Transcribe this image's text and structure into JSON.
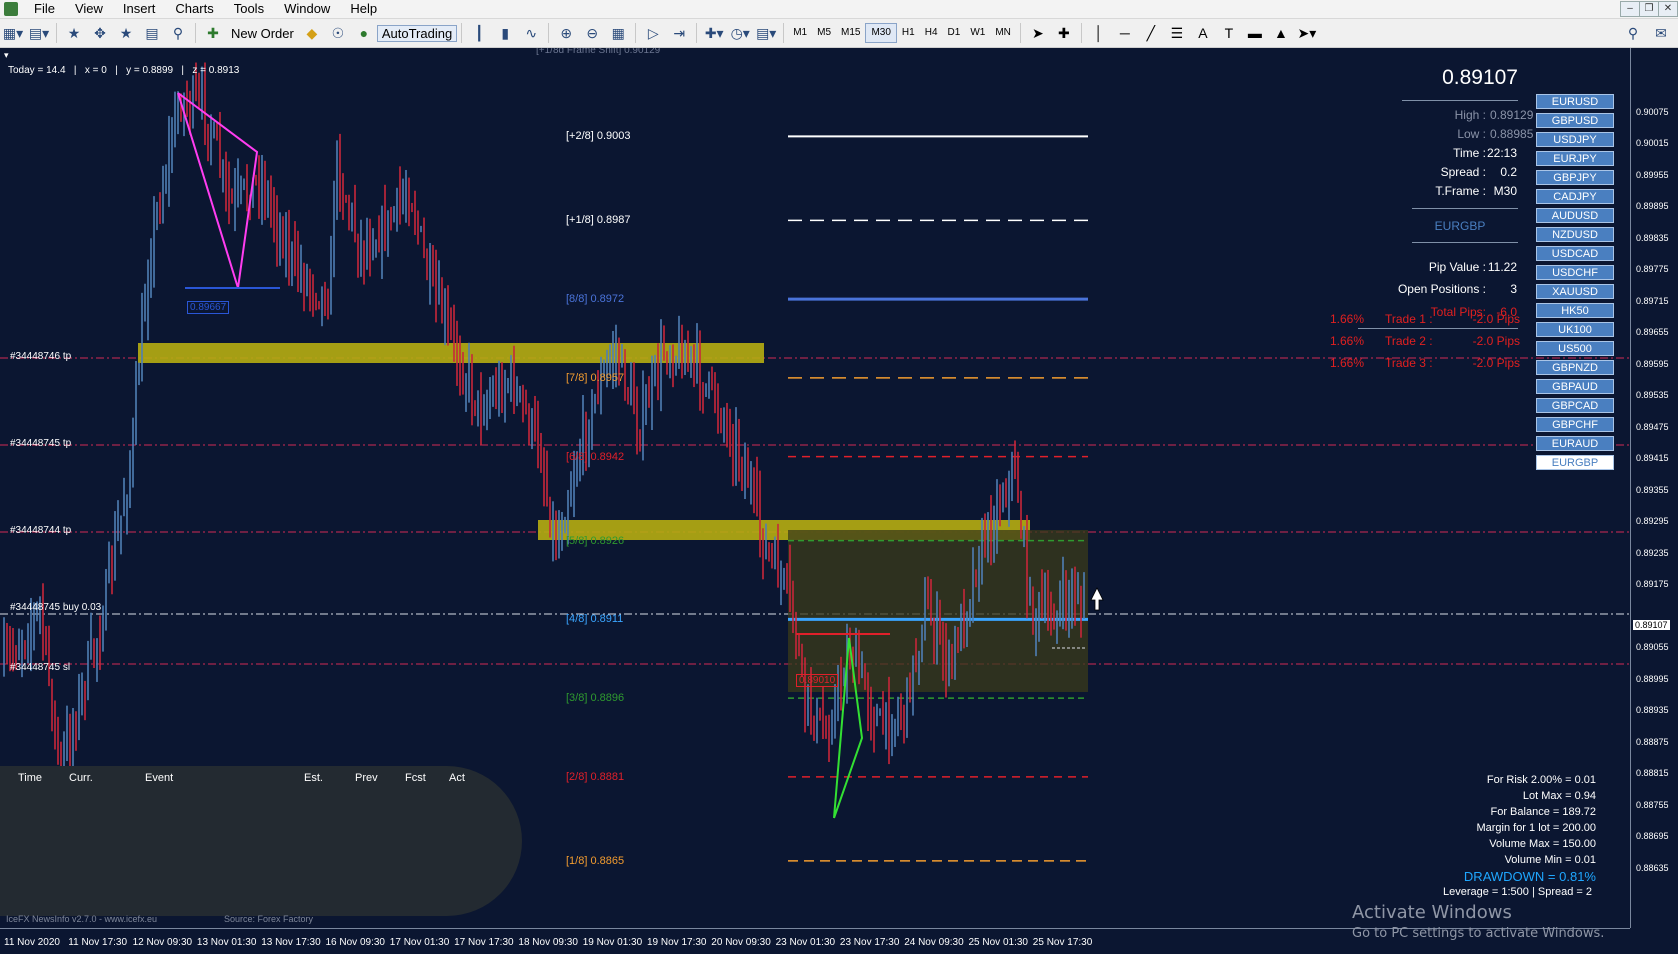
{
  "menu": [
    "File",
    "View",
    "Insert",
    "Charts",
    "Tools",
    "Window",
    "Help"
  ],
  "toolbar": {
    "new_order": "New Order",
    "autotrading": "AutoTrading",
    "timeframes": [
      "M1",
      "M5",
      "M15",
      "M30",
      "H1",
      "H4",
      "D1",
      "W1",
      "MN"
    ],
    "active_timeframe": "M30"
  },
  "chart": {
    "crosshair": {
      "today": "Today = 14.4",
      "x": "x = 0",
      "y": "y = 0.8899",
      "z": "z = 0.8913"
    },
    "frame_shift_label": "[+1/8d Frame Shift]  0.90129",
    "murrey_levels": [
      {
        "label": "[+2/8]",
        "value": "0.9003",
        "color": "#ffffff"
      },
      {
        "label": "[+1/8]",
        "value": "0.8987",
        "color": "#ffffff"
      },
      {
        "label": "[8/8]",
        "value": "0.8972",
        "color": "#4a73d9"
      },
      {
        "label": "[7/8]",
        "value": "0.8957",
        "color": "#f39c2f"
      },
      {
        "label": "[6/8]",
        "value": "0.8942",
        "color": "#e0202a"
      },
      {
        "label": "[5/8]",
        "value": "0.8926",
        "color": "#2f9a2f"
      },
      {
        "label": "[4/8]",
        "value": "0.8911",
        "color": "#3aa5ff"
      },
      {
        "label": "[3/8]",
        "value": "0.8896",
        "color": "#2f9a2f"
      },
      {
        "label": "[2/8]",
        "value": "0.8881",
        "color": "#e0202a"
      },
      {
        "label": "[1/8]",
        "value": "0.8865",
        "color": "#f39c2f"
      }
    ],
    "order_labels": [
      "#34448746 tp",
      "#34448745 tp",
      "#34448744 tp",
      "#34448745 buy 0.03",
      "#34448745 sl"
    ],
    "blue_box_label": "0.89667",
    "red_box_label": "0.89010",
    "current_price_tag": "0.89107",
    "price_ticks": [
      "0.90075",
      "0.90015",
      "0.89955",
      "0.89895",
      "0.89835",
      "0.89775",
      "0.89715",
      "0.89655",
      "0.89595",
      "0.89535",
      "0.89475",
      "0.89415",
      "0.89355",
      "0.89295",
      "0.89235",
      "0.89175",
      "0.89055",
      "0.88995",
      "0.88935",
      "0.88875",
      "0.88815",
      "0.88755",
      "0.88695",
      "0.88635"
    ],
    "time_ticks": [
      "11 Nov 2020",
      "11 Nov 17:30",
      "12 Nov 09:30",
      "13 Nov 01:30",
      "13 Nov 17:30",
      "16 Nov 09:30",
      "17 Nov 01:30",
      "17 Nov 17:30",
      "18 Nov 09:30",
      "19 Nov 01:30",
      "19 Nov 17:30",
      "20 Nov 09:30",
      "23 Nov 01:30",
      "23 Nov 17:30",
      "24 Nov 09:30",
      "25 Nov 01:30",
      "25 Nov 17:30"
    ]
  },
  "panel": {
    "price": "0.89107",
    "high_label": "High :",
    "high": "0.89129",
    "low_label": "Low :",
    "low": "0.88985",
    "time_label": "Time :",
    "time": "22:13",
    "spread_label": "Spread :",
    "spread": "0.2",
    "tframe_label": "T.Frame :",
    "tframe": "M30",
    "symbol": "EURGBP",
    "pip_label": "Pip Value :",
    "pip_value": "11.22",
    "open_label": "Open Positions :",
    "open_positions": "3",
    "total_label": "Total Pips:",
    "total_pips": "-6.0",
    "trades": [
      {
        "pct": "1.66%",
        "name": "Trade 1 :",
        "pips": "-2.0 Pips"
      },
      {
        "pct": "1.66%",
        "name": "Trade 2 :",
        "pips": "-2.0 Pips"
      },
      {
        "pct": "1.66%",
        "name": "Trade 3 :",
        "pips": "-2.0 Pips"
      }
    ]
  },
  "symbols": [
    "EURUSD",
    "GBPUSD",
    "USDJPY",
    "EURJPY",
    "GBPJPY",
    "CADJPY",
    "AUDUSD",
    "NZDUSD",
    "USDCAD",
    "USDCHF",
    "XAUUSD",
    "HK50",
    "UK100",
    "US500",
    "GBPNZD",
    "GBPAUD",
    "GBPCAD",
    "GBPCHF",
    "EURAUD",
    "EURGBP"
  ],
  "active_symbol": "EURGBP",
  "news": {
    "headers": [
      "Time",
      "Curr.",
      "Event",
      "Est.",
      "Prev",
      "Fcst",
      "Act"
    ],
    "footer_left": "IceFX NewsInfo v2.7.0  -  www.icefx.eu",
    "footer_right": "Source: Forex Factory"
  },
  "risk": {
    "for_risk": "For Risk 2.00% = 0.01",
    "lot_max": "Lot Max = 0.94",
    "balance": "For Balance = 189.72",
    "margin": "Margin for 1 lot = 200.00",
    "vol_max": "Volume Max = 150.00",
    "vol_min": "Volume Min = 0.01",
    "drawdown": "DRAWDOWN =  0.81%",
    "leverage": "Leverage = 1:500 | Spread = 2"
  },
  "activate": {
    "title": "Activate Windows",
    "subtitle": "Go to PC settings to activate Windows."
  },
  "colors": {
    "background": "#0b1631",
    "bull": "#4f7fb5",
    "bear": "#c8273a",
    "zone": "#b6ad12",
    "accent_blue": "#4a7fc0"
  }
}
